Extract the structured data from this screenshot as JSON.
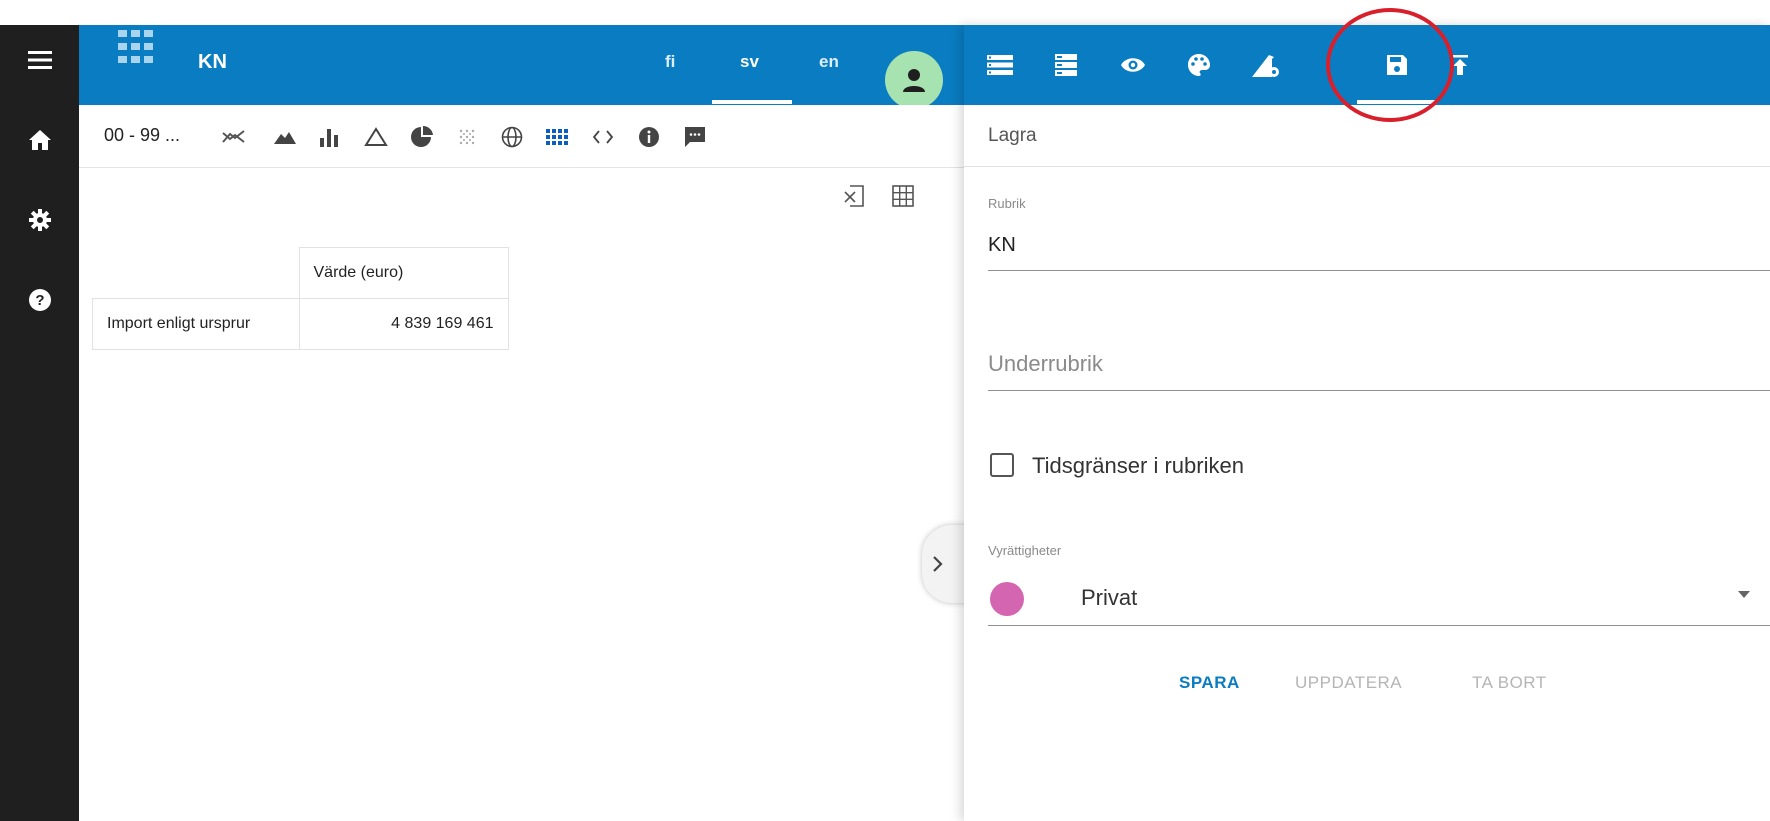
{
  "app": {
    "title": "KN",
    "languages": [
      {
        "code": "fi",
        "active": false
      },
      {
        "code": "sv",
        "active": true
      },
      {
        "code": "en",
        "active": false
      }
    ],
    "colors": {
      "primary": "#0a7cc1",
      "sidebar": "#1f1f1f",
      "avatar_bg": "#a6e3b0",
      "highlight_ring": "#d8202d",
      "visibility_dot": "#d465b0",
      "action_enabled": "#0a7cc1",
      "action_disabled": "#b5b5b5"
    }
  },
  "sidebar": {
    "items": [
      {
        "icon": "menu-icon"
      },
      {
        "icon": "home-icon"
      },
      {
        "icon": "gear-icon"
      },
      {
        "icon": "help-icon"
      }
    ]
  },
  "toolbar": {
    "range_label": "00 - 99 ...",
    "icons": [
      "line-chart-icon",
      "area-chart-icon",
      "bar-chart-icon",
      "triangle-chart-icon",
      "pie-chart-icon",
      "dot-grid-icon",
      "globe-icon",
      "table-icon",
      "code-icon",
      "info-icon",
      "comment-icon"
    ],
    "active_icon": "table-icon"
  },
  "table_tools": [
    "export-icon",
    "grid-icon"
  ],
  "table": {
    "header": [
      "",
      "Värde (euro)"
    ],
    "rows": [
      {
        "label": "Import enligt ursprur",
        "value": "4 839 169 461"
      }
    ]
  },
  "panel": {
    "toolbar_icons": [
      "list-icon",
      "storage-icon",
      "eye-icon",
      "palette-icon",
      "chart-settings-icon",
      "save-icon",
      "upload-icon"
    ],
    "active_icon": "save-icon",
    "heading": "Lagra",
    "fields": {
      "rubrik_label": "Rubrik",
      "rubrik_value": "KN",
      "underrubrik_placeholder": "Underrubrik",
      "time_limits_label": "Tidsgränser i rubriken",
      "time_limits_checked": false,
      "visibility_label": "Vyrättigheter",
      "visibility_value": "Privat"
    },
    "actions": {
      "save": "SPARA",
      "update": "UPPDATERA",
      "delete": "TA BORT"
    }
  }
}
